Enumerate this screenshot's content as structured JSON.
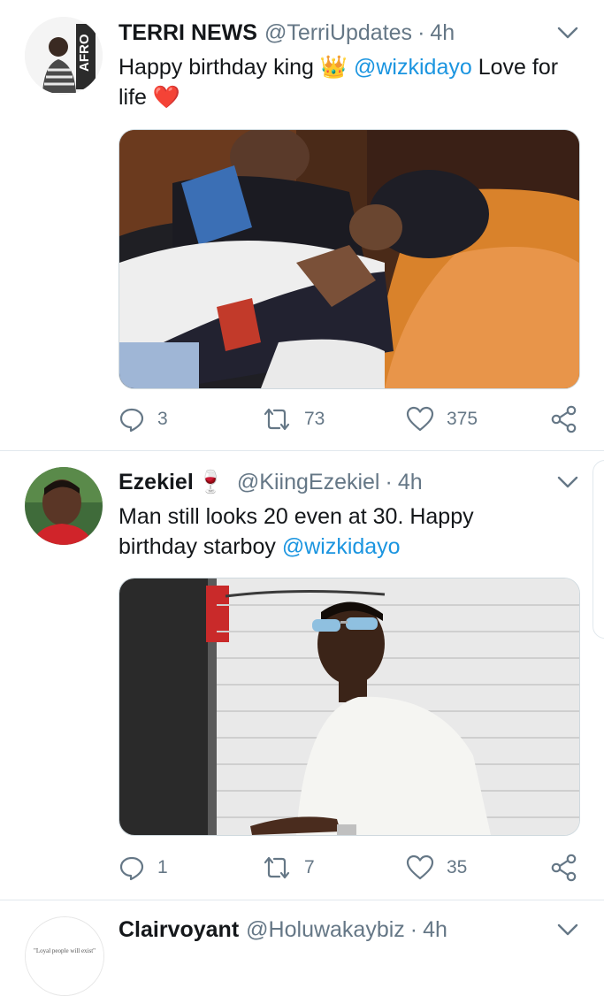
{
  "tweets": [
    {
      "name": "TERRI NEWS",
      "badge": "",
      "handle": "@TerriUpdates",
      "sep": "·",
      "time": "4h",
      "text_parts": [
        "Happy birthday king ",
        "👑",
        " ",
        "@wizkidayo",
        " Love for life ",
        "❤️"
      ],
      "avatar_text": "AFRO",
      "replies": "3",
      "retweets": "73",
      "likes": "375"
    },
    {
      "name": "Ezekiel",
      "badge": "🍷",
      "handle": "@KiingEzekiel",
      "sep": "·",
      "time": "4h",
      "text_parts": [
        "Man still looks 20 even at 30. Happy birthday starboy ",
        "@wizkidayo"
      ],
      "replies": "1",
      "retweets": "7",
      "likes": "35"
    },
    {
      "name": "Clairvoyant",
      "handle": "@Holuwakaybiz",
      "sep": "·",
      "time": "4h",
      "avatar_text": "\"Loyal people will exist\""
    }
  ],
  "colors": {
    "mention": "#1b95e0",
    "secondary": "#657786",
    "divider": "#e1e8ed"
  },
  "icons": [
    "reply-icon",
    "retweet-icon",
    "like-icon",
    "share-icon",
    "chevron-down-icon"
  ]
}
